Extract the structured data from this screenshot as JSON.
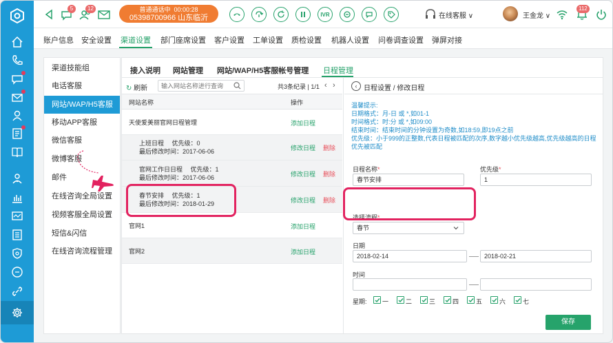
{
  "topbar": {
    "call_status": "普通通话中",
    "call_time": "00:00:28",
    "call_number": "05398700966 山东临沂",
    "badges": {
      "chat": "5",
      "users": "12",
      "wifi": "112"
    },
    "ivr_label": "IVR",
    "agent_status": "在线客服",
    "user_name": "王金龙"
  },
  "menu": {
    "items": [
      "账户信息",
      "安全设置",
      "渠道设置",
      "部门座席设置",
      "客户设置",
      "工单设置",
      "质检设置",
      "机器人设置",
      "问卷调查设置",
      "弹屏对接"
    ],
    "active": "渠道设置"
  },
  "left_nav": {
    "items": [
      "渠道技能组",
      "电话客服",
      "网站/WAP/H5客服",
      "移动APP客服",
      "微信客服",
      "微博客服",
      "邮件",
      "在线咨询全局设置",
      "视频客服全局设置",
      "短信&闪信",
      "在线咨询流程管理"
    ],
    "active": "网站/WAP/H5客服"
  },
  "subtabs": {
    "items": [
      "接入说明",
      "网站管理",
      "网站/WAP/H5客服帐号管理",
      "日程管理"
    ],
    "active": "日程管理"
  },
  "list": {
    "refresh_label": "刷新",
    "search_placeholder": "输入网站名称进行查询",
    "pager_text": "共3条纪录 | 1/1",
    "col_name": "网站名称",
    "col_op": "操作",
    "rows": [
      {
        "name": "天使爱美丽官网日程管理",
        "op": "添加日程"
      },
      {
        "line1": "上班日程　 优先级：0",
        "line2": "最后修改时间：2017-06-06",
        "edit": "修改日程",
        "del": "删除"
      },
      {
        "line1": "官网工作日日程　 优先级：1",
        "line2": "最后修改时间：2017-06-06",
        "edit": "修改日程",
        "del": "删除"
      },
      {
        "line1": "春节安排　 优先级：1",
        "line2": "最后修改时间：2018-01-29",
        "edit": "修改日程",
        "del": "删除"
      },
      {
        "name": "官网1",
        "op": "添加日程"
      },
      {
        "name": "官网2",
        "op": "添加日程"
      }
    ]
  },
  "form": {
    "breadcrumb": "日程设置 / 修改日程",
    "tips": [
      "温馨提示:",
      "日期格式：月-日 或 *,如01-1",
      "时间格式：时:分 或 *,如09:00",
      "结束时间：结束时间的分钟设置为奇数,如18:59,即19点之前",
      "优先级：小于999的正整数,代表日程被匹配的次序,数字越小优先级越高,优先级越高的日程优先被匹配"
    ],
    "name_label": "日程名称",
    "name_value": "春节安排",
    "priority_label": "优先级",
    "priority_value": "1",
    "flow_label": "选择流程",
    "flow_value": "春节",
    "date_label": "日期",
    "date_start": "2018-02-14",
    "date_end": "2018-02-21",
    "time_label": "时间",
    "time_start": "",
    "time_end": "",
    "week_label": "星期:",
    "weekdays": [
      "一",
      "二",
      "三",
      "四",
      "五",
      "六",
      "七"
    ],
    "save_label": "保存",
    "required_mark": "*"
  },
  "colors": {
    "accent": "#25a16a",
    "sidebar": "#1e9bd6",
    "highlight": "#e2225f",
    "call": "#f07c32"
  }
}
